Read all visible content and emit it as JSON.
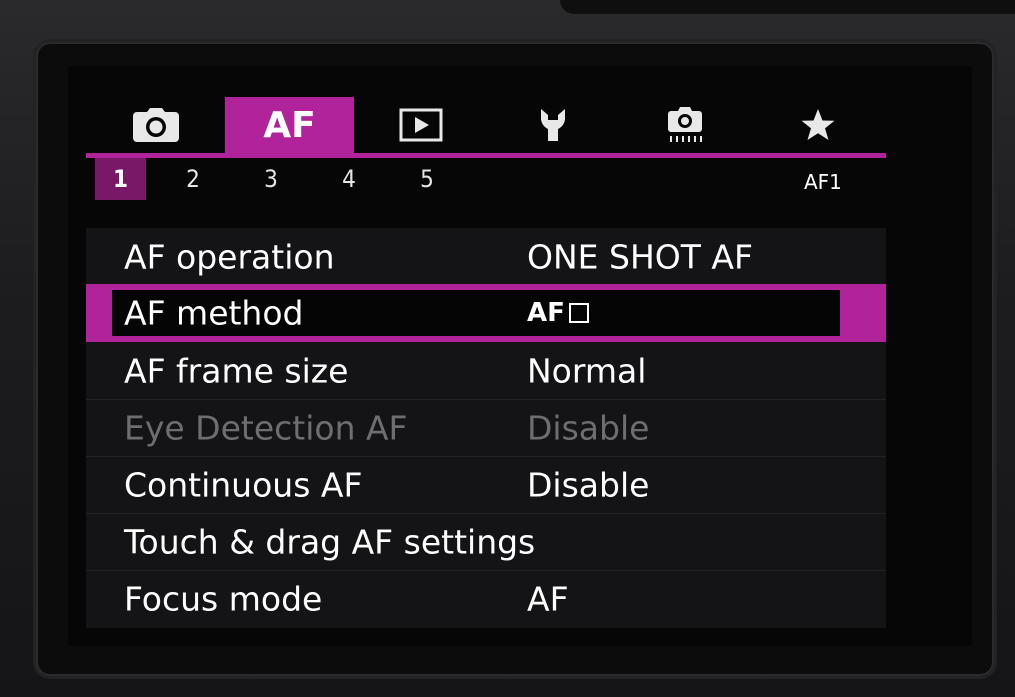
{
  "tabs": [
    {
      "name": "shooting",
      "icon": "camera-icon",
      "label": ""
    },
    {
      "name": "af",
      "icon": "",
      "label": "AF",
      "active": true
    },
    {
      "name": "playback",
      "icon": "play-icon",
      "label": ""
    },
    {
      "name": "setup",
      "icon": "wrench-icon",
      "label": ""
    },
    {
      "name": "custom-functions",
      "icon": "camera-custom-icon",
      "label": ""
    },
    {
      "name": "my-menu",
      "icon": "star-icon",
      "label": ""
    }
  ],
  "subtabs": [
    "1",
    "2",
    "3",
    "4",
    "5"
  ],
  "active_subtab": "1",
  "page_code": "AF1",
  "menu": {
    "items": [
      {
        "label": "AF operation",
        "value": "ONE SHOT AF",
        "state": "normal"
      },
      {
        "label": "AF method",
        "value": "AF",
        "value_icon": "af-frame-icon",
        "state": "selected"
      },
      {
        "label": "AF frame size",
        "value": "Normal",
        "state": "normal"
      },
      {
        "label": "Eye Detection AF",
        "value": "Disable",
        "state": "disabled"
      },
      {
        "label": "Continuous AF",
        "value": "Disable",
        "state": "normal"
      },
      {
        "label": "Touch & drag AF settings",
        "value": "",
        "state": "normal"
      },
      {
        "label": "Focus mode",
        "value": "AF",
        "state": "normal"
      }
    ]
  },
  "colors": {
    "accent": "#b0239a",
    "subtab_active": "#7a1868",
    "disabled_text": "#6e6e70",
    "text": "#ffffff"
  }
}
